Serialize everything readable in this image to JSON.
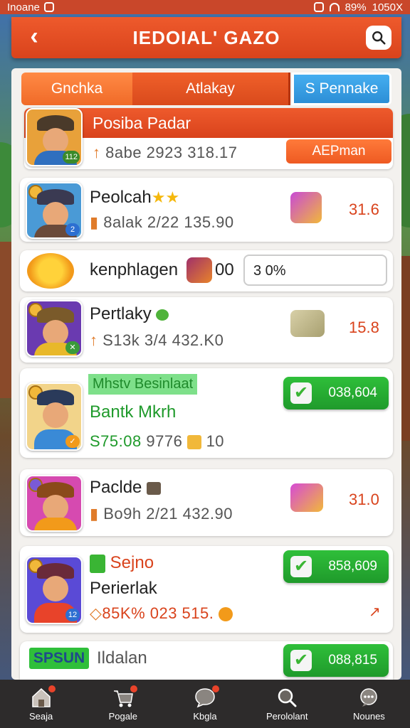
{
  "status_bar": {
    "left_text": "Inoane",
    "battery": "89%",
    "time": "1050X"
  },
  "header": {
    "title": "IEDOIAL' GAZO"
  },
  "tabs": [
    {
      "label": "Gnchka"
    },
    {
      "label": "Atlakay"
    },
    {
      "label": "S Pennake"
    }
  ],
  "featured": {
    "title": "Posiba Padar",
    "stats": "8abe 2923 318.17",
    "badge": "112",
    "button_label": "AEPman"
  },
  "rows": [
    {
      "name": "Peolcah",
      "stats": "8alak 2/22 135.90",
      "value": "31.6",
      "badge": "2"
    },
    {
      "name": "kenphlagen",
      "count": "00",
      "input_value": "3 0%"
    },
    {
      "name": "Pertlaky",
      "stats": "S13k 3/4 432.K0",
      "value": "15.8"
    },
    {
      "tag": "Mhstv Besinlaat",
      "name": "Bantk Mkrh",
      "stats_green": "S75:08",
      "stats_rest": "9776",
      "extra": "10",
      "pill_value": "038,604"
    },
    {
      "name": "Paclde",
      "stats": "Bo9h 2/21 432.90",
      "value": "31.0"
    },
    {
      "tag": "Sejno",
      "name": "Perierlak",
      "stats": "85K% 023 515.",
      "pill_value": "858,609",
      "badge": "12"
    },
    {
      "tag": "SPSUN",
      "name": "Ildalan",
      "pill_value": "088,815"
    }
  ],
  "nav": [
    {
      "label": "Seaja",
      "icon": "home-icon"
    },
    {
      "label": "Pogale",
      "icon": "cart-icon"
    },
    {
      "label": "Kbgla",
      "icon": "chat-icon"
    },
    {
      "label": "Perololant",
      "icon": "search-icon"
    },
    {
      "label": "Nounes",
      "icon": "message-icon"
    }
  ],
  "colors": {
    "accent": "#d9431c",
    "green": "#1f9a2b",
    "blue": "#2c8ed6",
    "nav_bg": "#2d2b2b"
  }
}
